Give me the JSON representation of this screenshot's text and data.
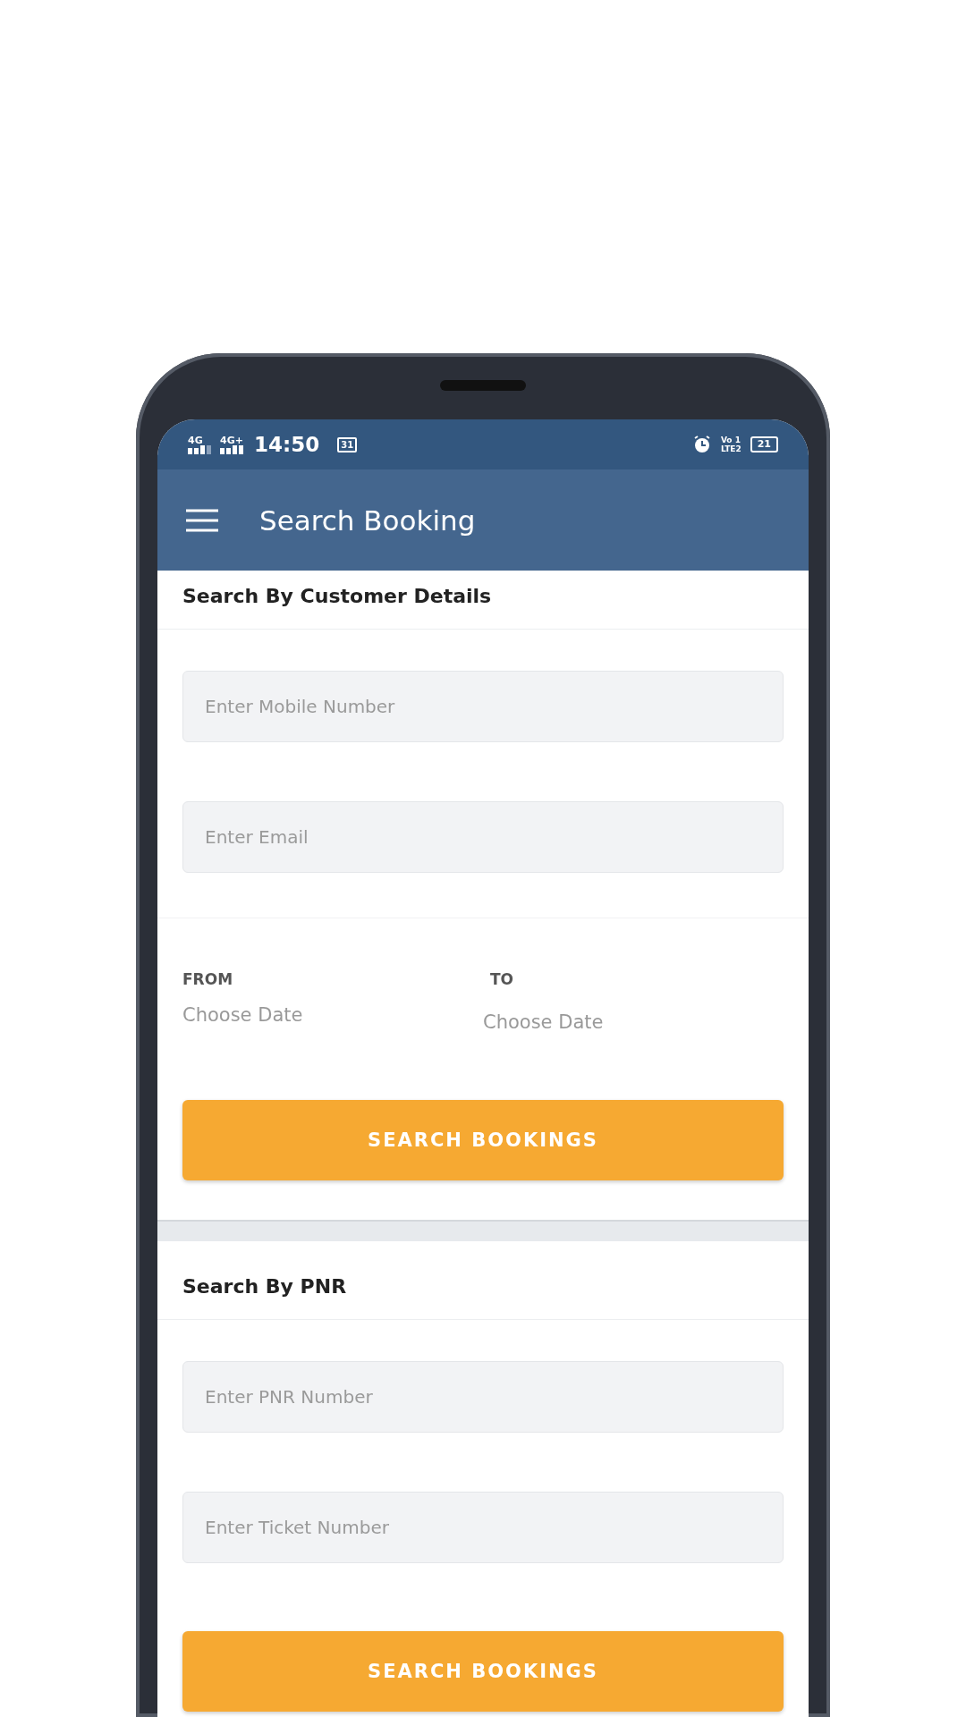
{
  "status_bar": {
    "networks": [
      "4G",
      "4G+"
    ],
    "time": "14:50",
    "calendar": "31",
    "volte_top": "Vo 1",
    "volte_bottom": "LTE2",
    "battery": "21"
  },
  "app_bar": {
    "title": "Search Booking"
  },
  "sections": [
    {
      "title": "Search By Customer Details",
      "fields": [
        {
          "placeholder": "Enter Mobile Number"
        },
        {
          "placeholder": "Enter Email"
        }
      ],
      "dates": [
        {
          "label": "FROM",
          "placeholder": "Choose Date"
        },
        {
          "label": "TO",
          "placeholder": "Choose Date"
        }
      ],
      "button": "SEARCH BOOKINGS"
    },
    {
      "title": "Search By PNR",
      "fields": [
        {
          "placeholder": "Enter PNR Number"
        },
        {
          "placeholder": "Enter Ticket Number"
        }
      ],
      "button": "SEARCH BOOKINGS"
    }
  ]
}
